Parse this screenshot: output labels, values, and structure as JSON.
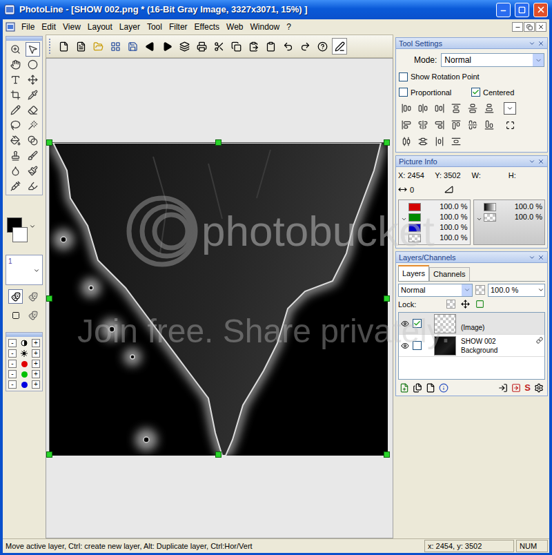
{
  "window": {
    "title": "PhotoLine - [SHOW 002.png * (16-Bit Gray Image, 3327x3071, 15%) ]"
  },
  "menu": [
    "File",
    "Edit",
    "View",
    "Layout",
    "Layer",
    "Tool",
    "Filter",
    "Effects",
    "Web",
    "Window",
    "?"
  ],
  "toolbox": {
    "tools": [
      {
        "selected": false
      },
      {
        "selected": true
      },
      {
        "selected": false
      },
      {
        "selected": false
      },
      {
        "selected": false
      },
      {
        "selected": false
      },
      {
        "selected": false
      },
      {
        "selected": false
      },
      {
        "selected": false
      },
      {
        "selected": false
      },
      {
        "selected": false
      },
      {
        "selected": false
      },
      {
        "selected": false
      },
      {
        "selected": false
      },
      {
        "selected": false
      },
      {
        "selected": false
      },
      {
        "selected": false
      },
      {
        "selected": false
      },
      {
        "selected": false
      },
      {
        "selected": false
      }
    ],
    "foreground": "#000000",
    "background": "#ffffff",
    "layer_box": "1",
    "adjust_rows": [
      {
        "kind": "contrast",
        "minus": "-",
        "plus": "+"
      },
      {
        "kind": "brightness",
        "minus": "-",
        "plus": "+"
      },
      {
        "kind": "channel",
        "color": "#e00000",
        "minus": "-",
        "plus": "+"
      },
      {
        "kind": "channel",
        "color": "#00c000",
        "minus": "-",
        "plus": "+"
      },
      {
        "kind": "channel",
        "color": "#0000e0",
        "minus": "-",
        "plus": "+"
      }
    ]
  },
  "tool_settings": {
    "title": "Tool Settings",
    "mode_label": "Mode:",
    "mode": "Normal",
    "checkboxes": [
      {
        "label": "Show Rotation Point",
        "checked": false
      },
      {
        "label": "Proportional",
        "checked": false
      },
      {
        "label": "Centered",
        "checked": true
      }
    ]
  },
  "picture_info": {
    "title": "Picture Info",
    "x_label": "X:",
    "x": "2454",
    "y_label": "Y:",
    "y": "3502",
    "w_label": "W:",
    "h_label": "H:",
    "distance": "0",
    "color_rows": [
      {
        "kind": "color",
        "color": "#d40000",
        "value": "100.0 %"
      },
      {
        "kind": "color",
        "color": "#008a00",
        "value": "100.0 %"
      },
      {
        "kind": "color",
        "color": "#0000c8",
        "value": "100.0 %"
      },
      {
        "kind": "alpha",
        "value": "100.0 %"
      }
    ],
    "gray_rows": [
      {
        "kind": "gray",
        "value": "100.0 %"
      },
      {
        "kind": "alpha",
        "value": "100.0 %"
      }
    ]
  },
  "layers": {
    "title": "Layers/Channels",
    "tabs": [
      {
        "label": "Layers",
        "selected": true
      },
      {
        "label": "Channels",
        "selected": false
      }
    ],
    "blend_mode": "Normal",
    "opacity": "100.0 %",
    "lock_label": "Lock:",
    "script_button": "S",
    "items": [
      {
        "name": "(Image)",
        "subtitle": "",
        "kind": "transparent",
        "selected": true,
        "visible": true,
        "checked": true
      },
      {
        "name": "SHOW 002",
        "subtitle": "Background",
        "kind": "dark",
        "selected": false,
        "visible": true,
        "checked": false
      }
    ]
  },
  "status_bar": {
    "hint": "Move active layer, Ctrl: create new layer, Alt: Duplicate layer, Ctrl:Hor/Vert",
    "coords": "x: 2454, y: 3502",
    "num": "NUM"
  },
  "watermark": {
    "brand": "photobucket",
    "tagline": "Join free. Share privately."
  }
}
